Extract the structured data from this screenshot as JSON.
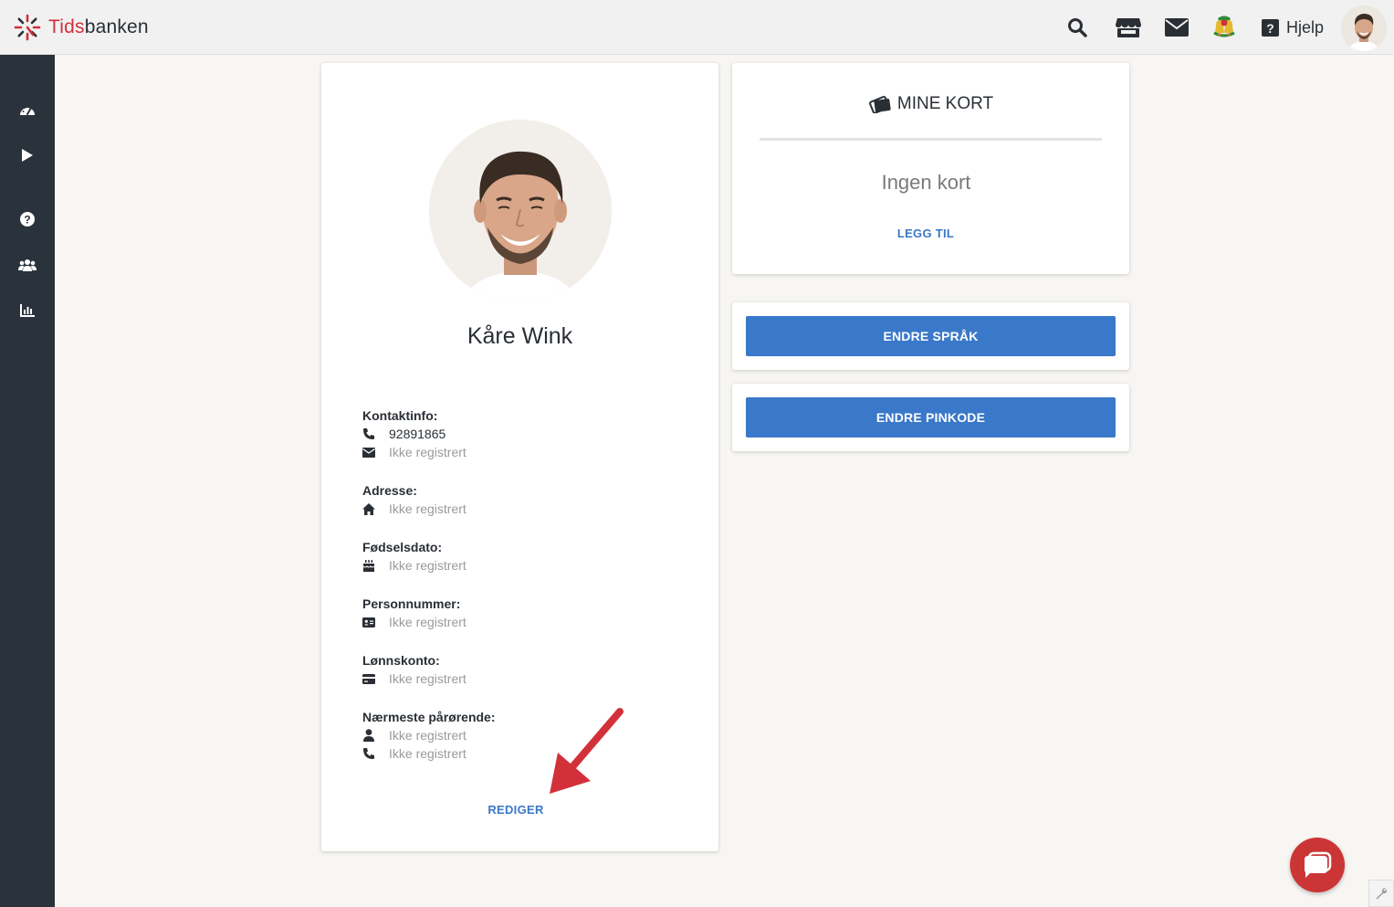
{
  "app": {
    "logo_part1": "Tids",
    "logo_part2": "banken"
  },
  "header": {
    "help_label": "Hjelp"
  },
  "profile": {
    "name": "Kåre Wink",
    "contact_label": "Kontaktinfo:",
    "phone": "92891865",
    "email": "Ikke registrert",
    "address_label": "Adresse:",
    "address": "Ikke registrert",
    "birthdate_label": "Fødselsdato:",
    "birthdate": "Ikke registrert",
    "personal_number_label": "Personnummer:",
    "personal_number": "Ikke registrert",
    "salary_account_label": "Lønnskonto:",
    "salary_account": "Ikke registrert",
    "next_of_kin_label": "Nærmeste pårørende:",
    "next_of_kin_name": "Ikke registrert",
    "next_of_kin_phone": "Ikke registrert",
    "edit_label": "REDIGER"
  },
  "my_cards": {
    "title": "MINE KORT",
    "empty_text": "Ingen kort",
    "add_label": "LEGG TIL"
  },
  "actions": {
    "change_language": "ENDRE SPRÅK",
    "change_pin": "ENDRE PINKODE"
  },
  "colors": {
    "accent": "#3a78c9",
    "sidebar": "#2a333b",
    "brand_red": "#d0303b",
    "arrow": "#d3313a"
  }
}
